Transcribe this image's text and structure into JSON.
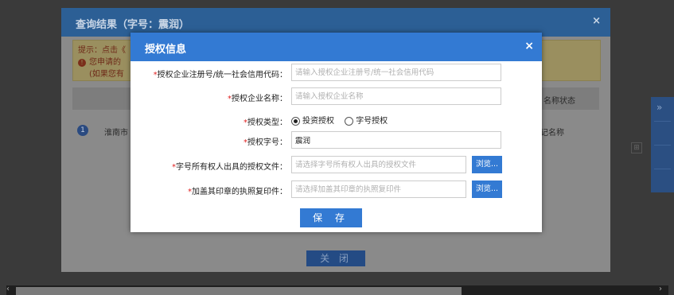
{
  "outer": {
    "title": "查询结果（字号：震润）",
    "close": "×",
    "tip_line1": "提示：点击《",
    "tip_line2": "您申请的",
    "tip_line3": "(如果您有",
    "column_status": "名称状态",
    "row_number": "1",
    "row_text": "淮南市",
    "row_status": "记名称",
    "close_label": "关 闭"
  },
  "side_tab": {
    "arrow": "»"
  },
  "modal": {
    "title": "授权信息",
    "close": "×",
    "fields": {
      "reg_code": {
        "label": "授权企业注册号/统一社会信用代码：",
        "placeholder": "请输入授权企业注册号/统一社会信用代码",
        "value": ""
      },
      "company_name": {
        "label": "授权企业名称：",
        "placeholder": "请输入授权企业名称",
        "value": ""
      },
      "auth_type": {
        "label": "授权类型：",
        "options": [
          "投资授权",
          "字号授权"
        ],
        "selected": "投资授权"
      },
      "auth_name": {
        "label": "授权字号：",
        "placeholder": "",
        "value": "震润"
      },
      "auth_file": {
        "label": "字号所有权人出具的授权文件：",
        "placeholder": "请选择字号所有权人出具的授权文件",
        "value": "",
        "browse": "浏览..."
      },
      "license_copy": {
        "label": "加盖其印章的执照复印件：",
        "placeholder": "请选择加盖其印章的执照复印件",
        "value": "",
        "browse": "浏览..."
      }
    },
    "required_mark": "*",
    "save_label": "保 存"
  },
  "colors": {
    "primary": "#337ad3",
    "outer_header": "#2c5f95",
    "required": "#e02020"
  }
}
